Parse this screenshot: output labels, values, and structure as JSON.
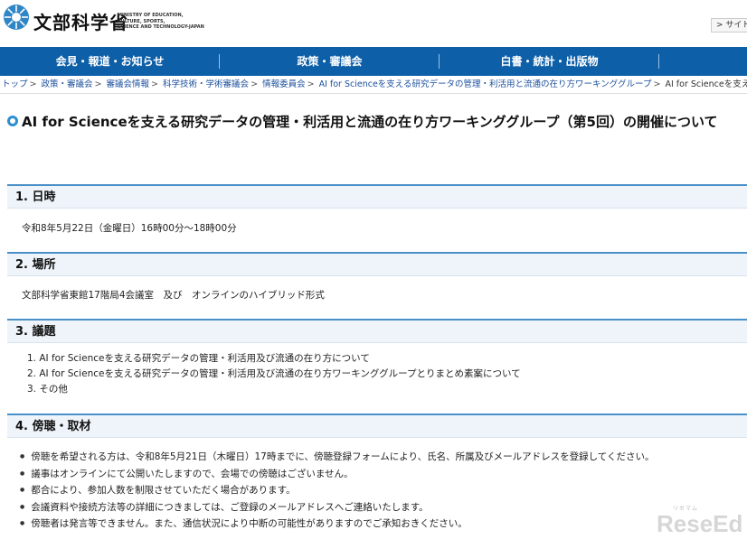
{
  "header": {
    "logo_text": "文部科学省",
    "logo_sub": [
      "MINISTRY OF EDUCATION,",
      "CULTURE, SPORTS,",
      "SCIENCE AND TECHNOLOGY-JAPAN"
    ],
    "sitemap_label": "> サイトマ"
  },
  "nav": {
    "items": [
      "会見・報道・お知らせ",
      "政策・審議会",
      "白書・統計・出版物"
    ]
  },
  "breadcrumb": {
    "items": [
      "トップ",
      "政策・審議会",
      "審議会情報",
      "科学技術・学術審議会",
      "情報委員会",
      "AI for Scienceを支える研究データの管理・利活用と流通の在り方ワーキンググループ",
      "AI for Scienceを支える研究データの管理・利活用と"
    ]
  },
  "page": {
    "title": "AI for Scienceを支える研究データの管理・利活用と流通の在り方ワーキンググループ（第5回）の開催について"
  },
  "sections": {
    "s1": {
      "heading": "1. 日時",
      "body": "令和8年5月22日（金曜日）16時00分～18時00分"
    },
    "s2": {
      "heading": "2. 場所",
      "body": "文部科学省東館17階局4会議室　及び　オンラインのハイブリッド形式"
    },
    "s3": {
      "heading": "3. 議題",
      "items": [
        "1. AI for Scienceを支える研究データの管理・利活用及び流通の在り方について",
        "2. AI for Scienceを支える研究データの管理・利活用及び流通の在り方ワーキンググループとりまとめ素案について",
        "3. その他"
      ]
    },
    "s4": {
      "heading": "4. 傍聴・取材",
      "items": [
        "傍聴を希望される方は、令和8年5月21日（木曜日）17時までに、傍聴登録フォームにより、氏名、所属及びメールアドレスを登録してください。",
        "議事はオンラインにて公開いたしますので、会場での傍聴はございません。",
        "都合により、参加人数を制限させていただく場合があります。",
        "会議資料や接続方法等の詳細につきましては、ご登録のメールアドレスへご連絡いたします。",
        "傍聴者は発言等できません。また、通信状況により中断の可能性がありますのでご承知おきください。"
      ]
    }
  },
  "watermark": {
    "text": "ReseEd",
    "small": "リセマム"
  },
  "colors": {
    "nav_bg": "#0d5fa8",
    "section_border": "#4a90c8",
    "section_bg": "#eef4fa",
    "link": "#1a4e9c"
  }
}
